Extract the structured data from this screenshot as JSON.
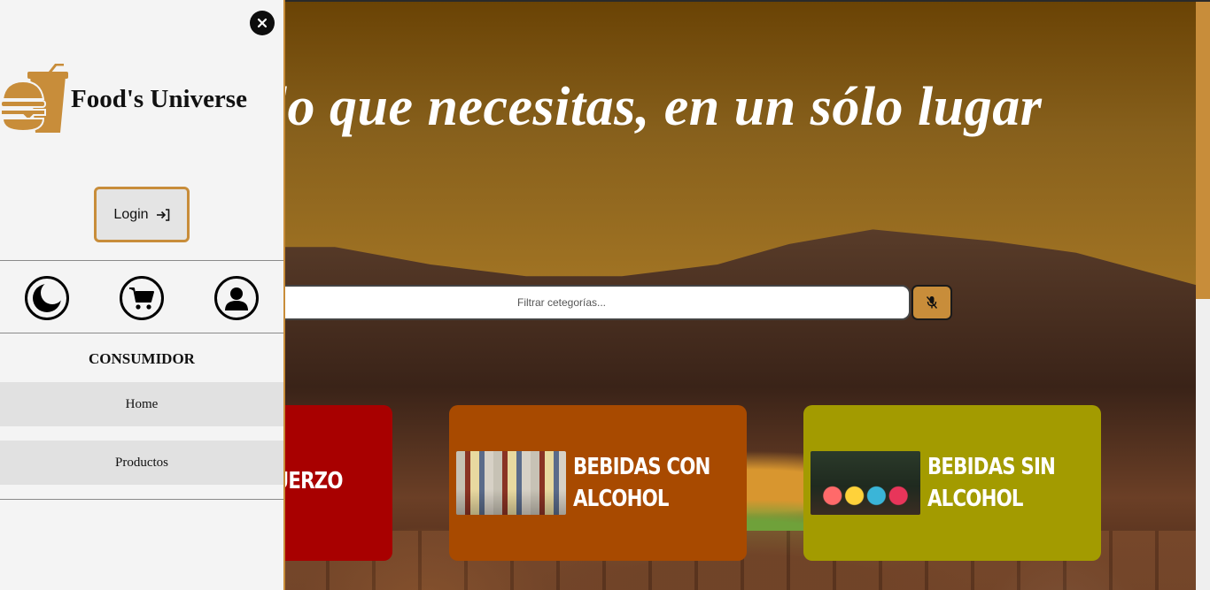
{
  "hero": {
    "slogan": "Todo lo que necesitas, en un sólo lugar"
  },
  "search": {
    "placeholder": "Filtrar cetegorías...",
    "mic_icon": "microphone-off-icon"
  },
  "categories": [
    {
      "title": "ALMUERZO",
      "color": "#a80000"
    },
    {
      "title": "BEBIDAS CON\nALCOHOL",
      "color": "#a84a00",
      "image": "liquor-bottles-photo"
    },
    {
      "title": "BEBIDAS SIN\nALCOHOL",
      "color": "#a39b00",
      "image": "cocktails-photo"
    }
  ],
  "drawer": {
    "close_icon": "close-icon",
    "brand_name": "Food's Universe",
    "logo": "burger-drink-logo",
    "login_label": "Login",
    "login_icon": "login-arrow-icon",
    "quick_icons": [
      "dark-mode-moon-icon",
      "cart-icon",
      "user-profile-icon"
    ],
    "role": "CONSUMIDOR",
    "nav": [
      {
        "label": "Home"
      },
      {
        "label": "Productos"
      }
    ]
  },
  "colors": {
    "accent": "#c88d3a",
    "hero_top": "#6a4305",
    "hero_bottom": "#a37524",
    "drawer_bg": "#f4f4f4"
  }
}
